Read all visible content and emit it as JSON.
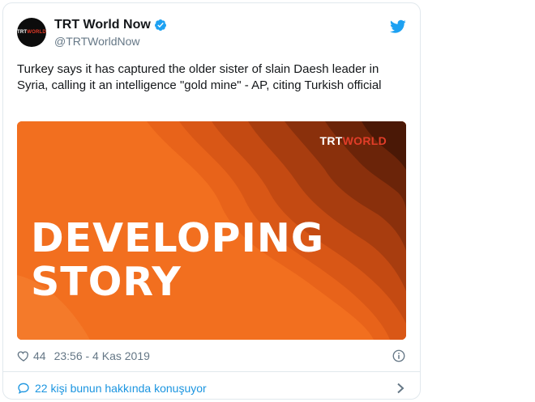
{
  "account": {
    "display_name": "TRT World Now",
    "handle": "@TRTWorldNow",
    "avatar_label_a": "TRT",
    "avatar_label_b": "WORLD",
    "verified_icon": "verified-badge-icon"
  },
  "tweet": {
    "text": "Turkey says it has captured the older sister of slain Daesh leader in Syria, calling it an intelligence \"gold mine\" - AP, citing Turkish official"
  },
  "media": {
    "logo_a": "TRT",
    "logo_b": "WORLD",
    "headline_line1": "DEVELOPING",
    "headline_line2": "STORY",
    "colors": [
      "#f26f1f",
      "#e8631a",
      "#d95716",
      "#c44a12",
      "#a83d0f",
      "#8a300c",
      "#6b2409",
      "#4a1806"
    ]
  },
  "meta": {
    "like_count": "44",
    "timestamp": "23:56 - 4 Kas 2019"
  },
  "conversation": {
    "label": "22 kişi bunun hakkında konuşuyor"
  },
  "colors": {
    "link": "#1b95e0",
    "muted": "#657786",
    "brand_red": "#e23d28"
  }
}
